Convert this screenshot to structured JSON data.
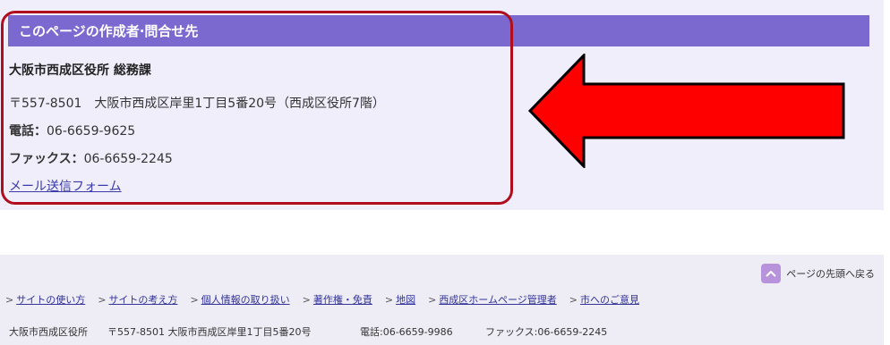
{
  "contact": {
    "header_title": "このページの作成者·問合せ先",
    "department": "大阪市西成区役所 総務課",
    "address": "〒557-8501　大阪市西成区岸里1丁目5番20号（西成区役所7階）",
    "phone_label": "電話：",
    "phone_value": "06-6659-9625",
    "fax_label": "ファックス：",
    "fax_value": "06-6659-2245",
    "mail_link": "メール送信フォーム"
  },
  "annotation": {
    "highlight_color": "#b00e1e",
    "arrow_color": "#ff0000",
    "arrow_direction": "left"
  },
  "footer": {
    "page_top_label": "ページの先頭へ戻る",
    "links": [
      "サイトの使い方",
      "サイトの考え方",
      "個人情報の取り扱い",
      "著作権・免責",
      "地図",
      "西成区ホームページ管理者",
      "市へのご意見"
    ],
    "info": {
      "office": "大阪市西成区役所",
      "address": "〒557-8501 大阪市西成区岸里1丁目5番20号",
      "tel": "電話:06-6659-9986",
      "fax": "ファックス:06-6659-2245"
    }
  },
  "colors": {
    "header_bg": "#7b69cf",
    "section_bg": "#efeefa",
    "link": "#3a3aa8",
    "page_top_icon": "#b793dc"
  }
}
